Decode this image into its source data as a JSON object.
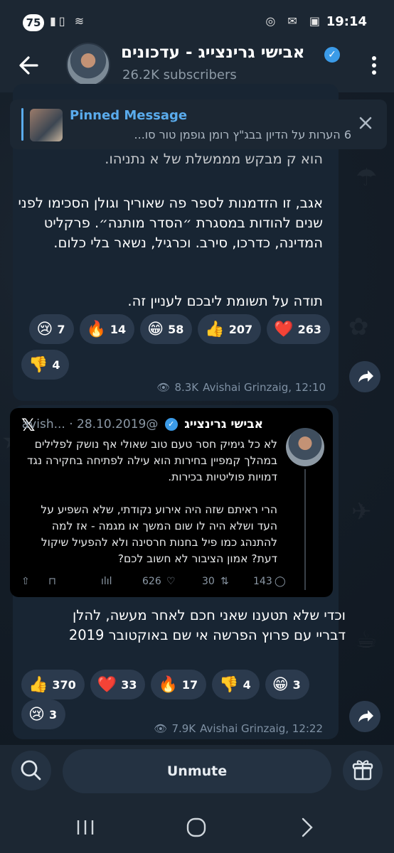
{
  "status_bar": {
    "badge": "75",
    "time": "19:14",
    "left_icons": "signal-wifi",
    "right_icons": "whatsapp-gmail-screenshot"
  },
  "header": {
    "title": "אבישי גרינצייג - עדכונים",
    "subscribers": "26.2K subscribers",
    "back_icon": "arrow-left-icon",
    "more_icon": "kebab-icon"
  },
  "pinned": {
    "title": "Pinned Message",
    "text": "6 הערות על הדיון בבג\"ץ רומן גופמן  טור סו..."
  },
  "message1": {
    "partial_line": "הוא ק מבקש מממשלת של א נתניהו.",
    "paragraph1": "אגב, זו הזדמנות לספר פה שאוריך וגולן הסכימו לפני שנים להודות במסגרת ״הסדר מותנה״. פרקליט המדינה, כדרכו, סירב. וכרגיל, נשאר בלי כלום.",
    "paragraph2": "תודה על תשומת ליבכם לעניין זה.",
    "reactions": [
      {
        "emoji": "❤️",
        "count": "263",
        "name": "heart"
      },
      {
        "emoji": "👍",
        "count": "207",
        "name": "thumbs-up"
      },
      {
        "emoji": "😁",
        "count": "58",
        "name": "grin"
      },
      {
        "emoji": "🔥",
        "count": "14",
        "name": "fire"
      },
      {
        "emoji": "😢",
        "count": "7",
        "name": "cry"
      },
      {
        "emoji": "👎",
        "count": "4",
        "name": "thumbs-down"
      }
    ],
    "views": "8.3K",
    "author": "Avishai Grinzaig, 12:10"
  },
  "tweet": {
    "name": "אבישי גרינצייג",
    "handle": "@avish...",
    "date": "28.10.2019",
    "dot": "·",
    "text1": "לא כל גימיק חסר טעם טוב שאולי אף נושק לפלילים במהלך קמפיין בחירות הוא עילה לפתיחה בחקירה נגד דמויות פוליטיות בכירות.",
    "text2": "הרי ראיתם שזה היה אירוע נקודתי, שלא השפיע על העד ושלא היה לו שום המשך או מגמה - אז למה להתנהג כמו פיל בחנות חרסינה ולא להפעיל שיקול דעת? אמון הציבור לא חשוב לכם?",
    "likes": "626",
    "retweets": "30",
    "replies": "143"
  },
  "message2": {
    "text": "וכדי שלא תטענו שאני חכם לאחר מעשה, להלן דבריי עם פרוץ הפרשה אי שם באוקטובר 2019",
    "reactions": [
      {
        "emoji": "👍",
        "count": "370",
        "name": "thumbs-up"
      },
      {
        "emoji": "❤️",
        "count": "33",
        "name": "heart"
      },
      {
        "emoji": "🔥",
        "count": "17",
        "name": "fire"
      },
      {
        "emoji": "👎",
        "count": "4",
        "name": "thumbs-down"
      },
      {
        "emoji": "😁",
        "count": "3",
        "name": "grin"
      },
      {
        "emoji": "😢",
        "count": "3",
        "name": "cry"
      }
    ],
    "views": "7.9K",
    "author": "Avishai Grinzaig, 12:22"
  },
  "bottom_bar": {
    "unmute_label": "Unmute",
    "search_icon": "search-icon",
    "gift_icon": "gift-icon"
  },
  "colors": {
    "accent": "#5aabec",
    "bubble": "#182533",
    "bar": "#1c2733",
    "reaction": "#2b3a4d"
  }
}
